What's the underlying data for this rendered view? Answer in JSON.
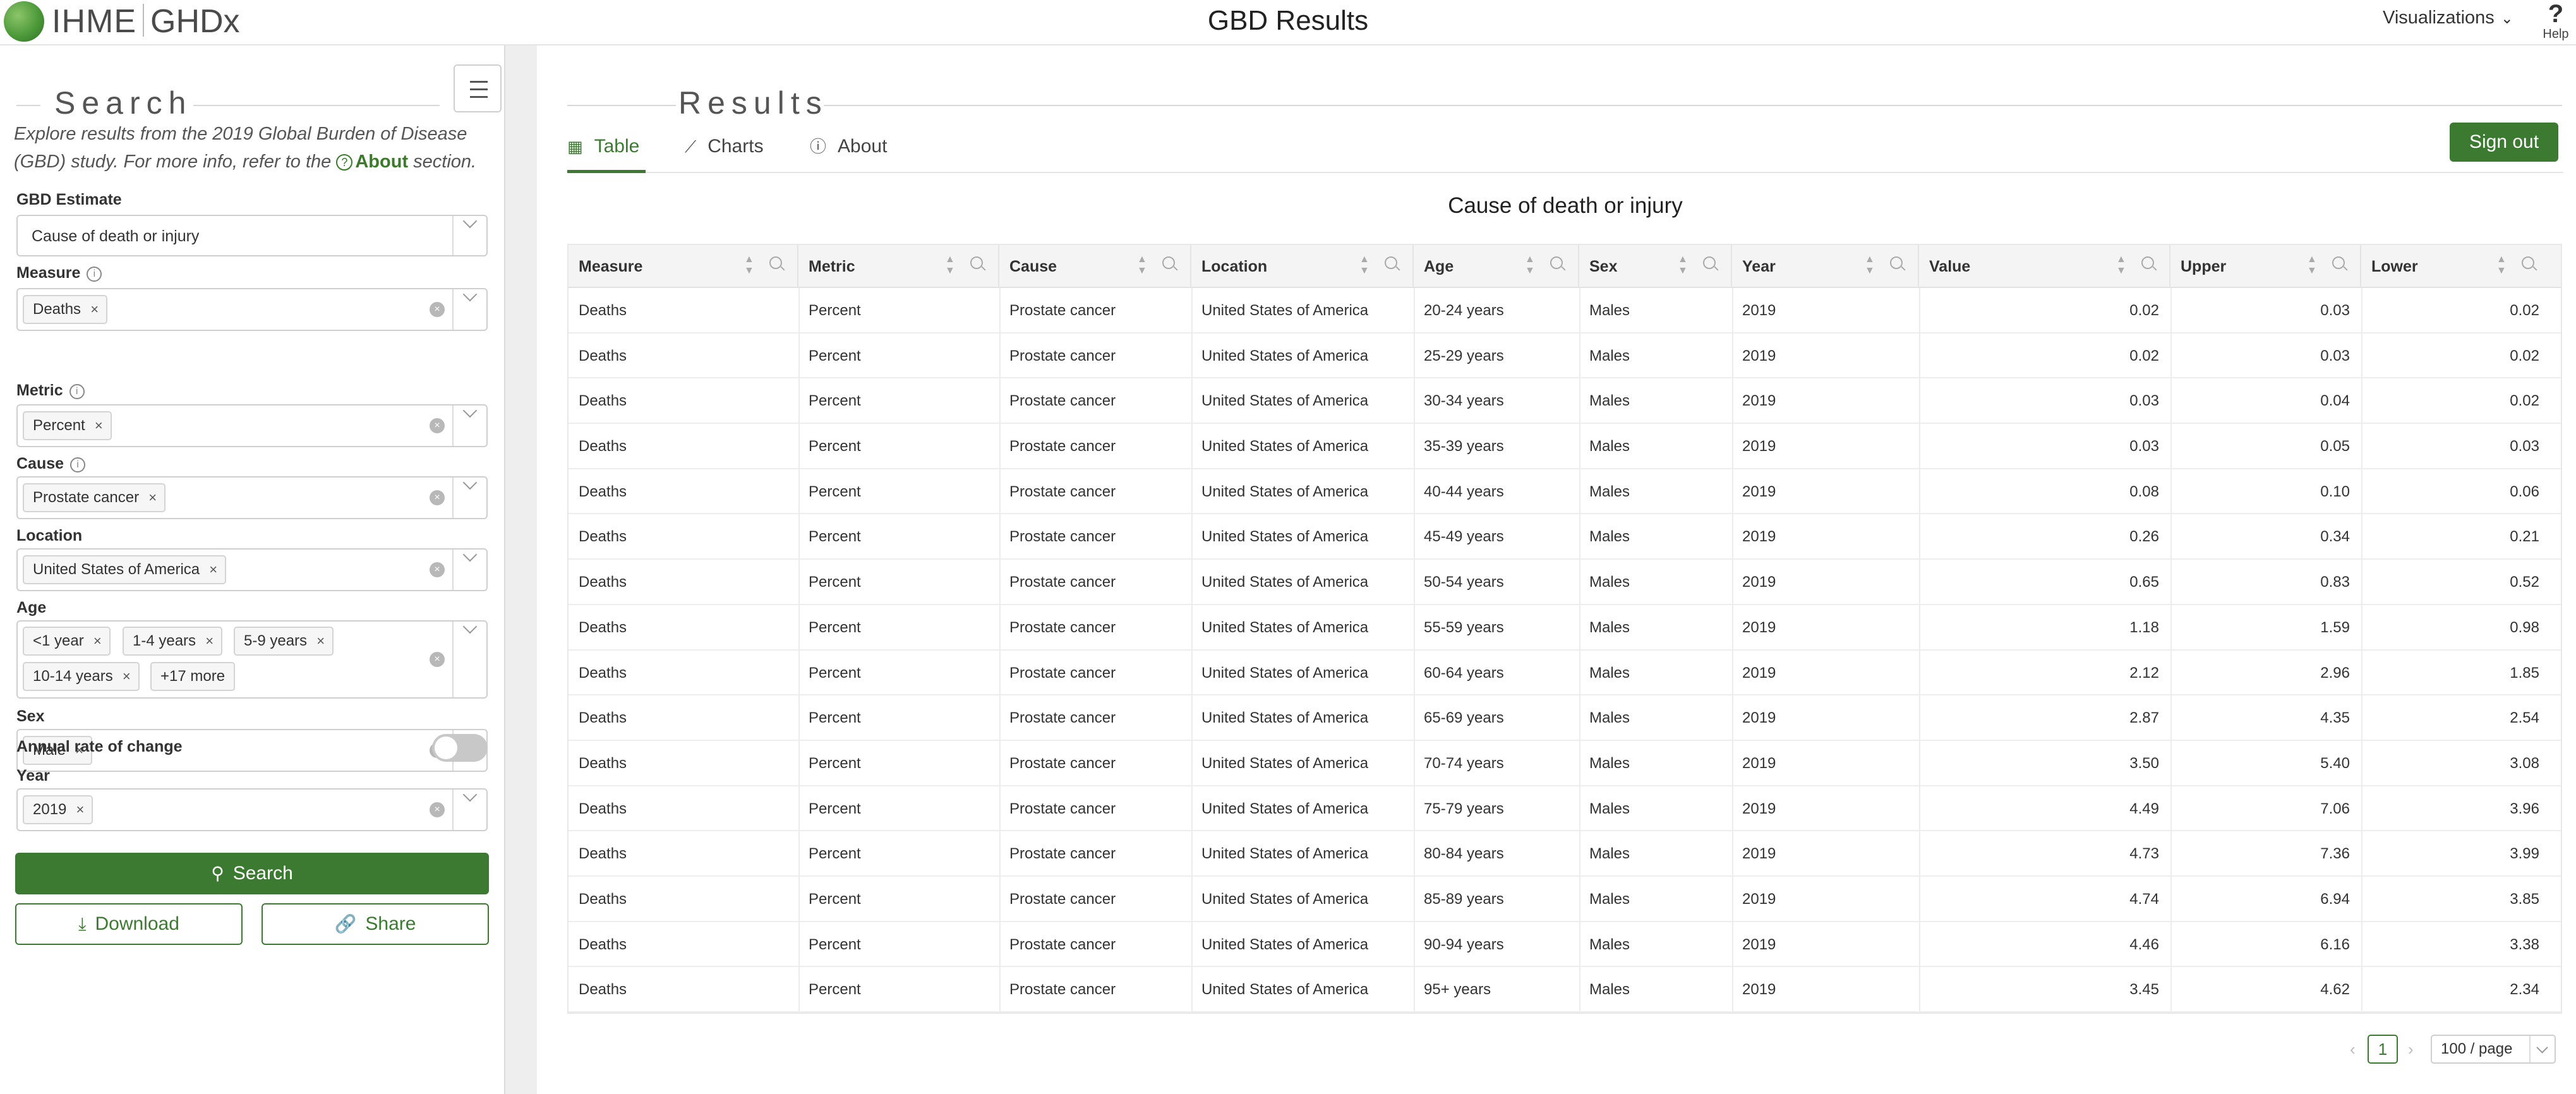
{
  "header": {
    "brand": "IHME",
    "brand2": "GHDx",
    "title": "GBD Results",
    "visualizations_label": "Visualizations",
    "help_label": "Help"
  },
  "sidebar": {
    "heading": "Search",
    "intro_text": "Explore results from the 2019 Global Burden of Disease (GBD) study. For more info, refer to the",
    "intro_link": "About",
    "intro_suffix": "section.",
    "fields": {
      "gbd_estimate": {
        "label": "GBD Estimate",
        "value": "Cause of death or injury"
      },
      "measure": {
        "label": "Measure",
        "tags": [
          "Deaths"
        ]
      },
      "metric": {
        "label": "Metric",
        "tags": [
          "Percent"
        ]
      },
      "cause": {
        "label": "Cause",
        "tags": [
          "Prostate cancer"
        ]
      },
      "location": {
        "label": "Location",
        "tags": [
          "United States of America"
        ]
      },
      "age": {
        "label": "Age",
        "tags": [
          "<1 year",
          "1-4 years",
          "5-9 years",
          "10-14 years"
        ],
        "more": "+17 more"
      },
      "sex": {
        "label": "Sex",
        "tags": [
          "Male"
        ]
      },
      "annual_rate": {
        "label": "Annual rate of change",
        "enabled": false
      },
      "year": {
        "label": "Year",
        "tags": [
          "2019"
        ]
      }
    },
    "buttons": {
      "search": "Search",
      "download": "Download",
      "share": "Share"
    }
  },
  "main": {
    "heading": "Results",
    "tabs": [
      "Table",
      "Charts",
      "About"
    ],
    "active_tab": "Table",
    "signout": "Sign out",
    "table_title": "Cause of death or injury",
    "columns": [
      "Measure",
      "Metric",
      "Cause",
      "Location",
      "Age",
      "Sex",
      "Year",
      "Value",
      "Upper",
      "Lower"
    ],
    "rows": [
      [
        "Deaths",
        "Percent",
        "Prostate cancer",
        "United States of America",
        "20-24 years",
        "Males",
        "2019",
        "0.02",
        "0.03",
        "0.02"
      ],
      [
        "Deaths",
        "Percent",
        "Prostate cancer",
        "United States of America",
        "25-29 years",
        "Males",
        "2019",
        "0.02",
        "0.03",
        "0.02"
      ],
      [
        "Deaths",
        "Percent",
        "Prostate cancer",
        "United States of America",
        "30-34 years",
        "Males",
        "2019",
        "0.03",
        "0.04",
        "0.02"
      ],
      [
        "Deaths",
        "Percent",
        "Prostate cancer",
        "United States of America",
        "35-39 years",
        "Males",
        "2019",
        "0.03",
        "0.05",
        "0.03"
      ],
      [
        "Deaths",
        "Percent",
        "Prostate cancer",
        "United States of America",
        "40-44 years",
        "Males",
        "2019",
        "0.08",
        "0.10",
        "0.06"
      ],
      [
        "Deaths",
        "Percent",
        "Prostate cancer",
        "United States of America",
        "45-49 years",
        "Males",
        "2019",
        "0.26",
        "0.34",
        "0.21"
      ],
      [
        "Deaths",
        "Percent",
        "Prostate cancer",
        "United States of America",
        "50-54 years",
        "Males",
        "2019",
        "0.65",
        "0.83",
        "0.52"
      ],
      [
        "Deaths",
        "Percent",
        "Prostate cancer",
        "United States of America",
        "55-59 years",
        "Males",
        "2019",
        "1.18",
        "1.59",
        "0.98"
      ],
      [
        "Deaths",
        "Percent",
        "Prostate cancer",
        "United States of America",
        "60-64 years",
        "Males",
        "2019",
        "2.12",
        "2.96",
        "1.85"
      ],
      [
        "Deaths",
        "Percent",
        "Prostate cancer",
        "United States of America",
        "65-69 years",
        "Males",
        "2019",
        "2.87",
        "4.35",
        "2.54"
      ],
      [
        "Deaths",
        "Percent",
        "Prostate cancer",
        "United States of America",
        "70-74 years",
        "Males",
        "2019",
        "3.50",
        "5.40",
        "3.08"
      ],
      [
        "Deaths",
        "Percent",
        "Prostate cancer",
        "United States of America",
        "75-79 years",
        "Males",
        "2019",
        "4.49",
        "7.06",
        "3.96"
      ],
      [
        "Deaths",
        "Percent",
        "Prostate cancer",
        "United States of America",
        "80-84 years",
        "Males",
        "2019",
        "4.73",
        "7.36",
        "3.99"
      ],
      [
        "Deaths",
        "Percent",
        "Prostate cancer",
        "United States of America",
        "85-89 years",
        "Males",
        "2019",
        "4.74",
        "6.94",
        "3.85"
      ],
      [
        "Deaths",
        "Percent",
        "Prostate cancer",
        "United States of America",
        "90-94 years",
        "Males",
        "2019",
        "4.46",
        "6.16",
        "3.38"
      ],
      [
        "Deaths",
        "Percent",
        "Prostate cancer",
        "United States of America",
        "95+ years",
        "Males",
        "2019",
        "3.45",
        "4.62",
        "2.34"
      ]
    ],
    "pagination": {
      "current": "1",
      "page_size": "100 / page"
    }
  },
  "colors": {
    "brand_green": "#3c7a31",
    "header_bg": "#f4f4f4",
    "sidebar_divider": "#eeeeee"
  }
}
